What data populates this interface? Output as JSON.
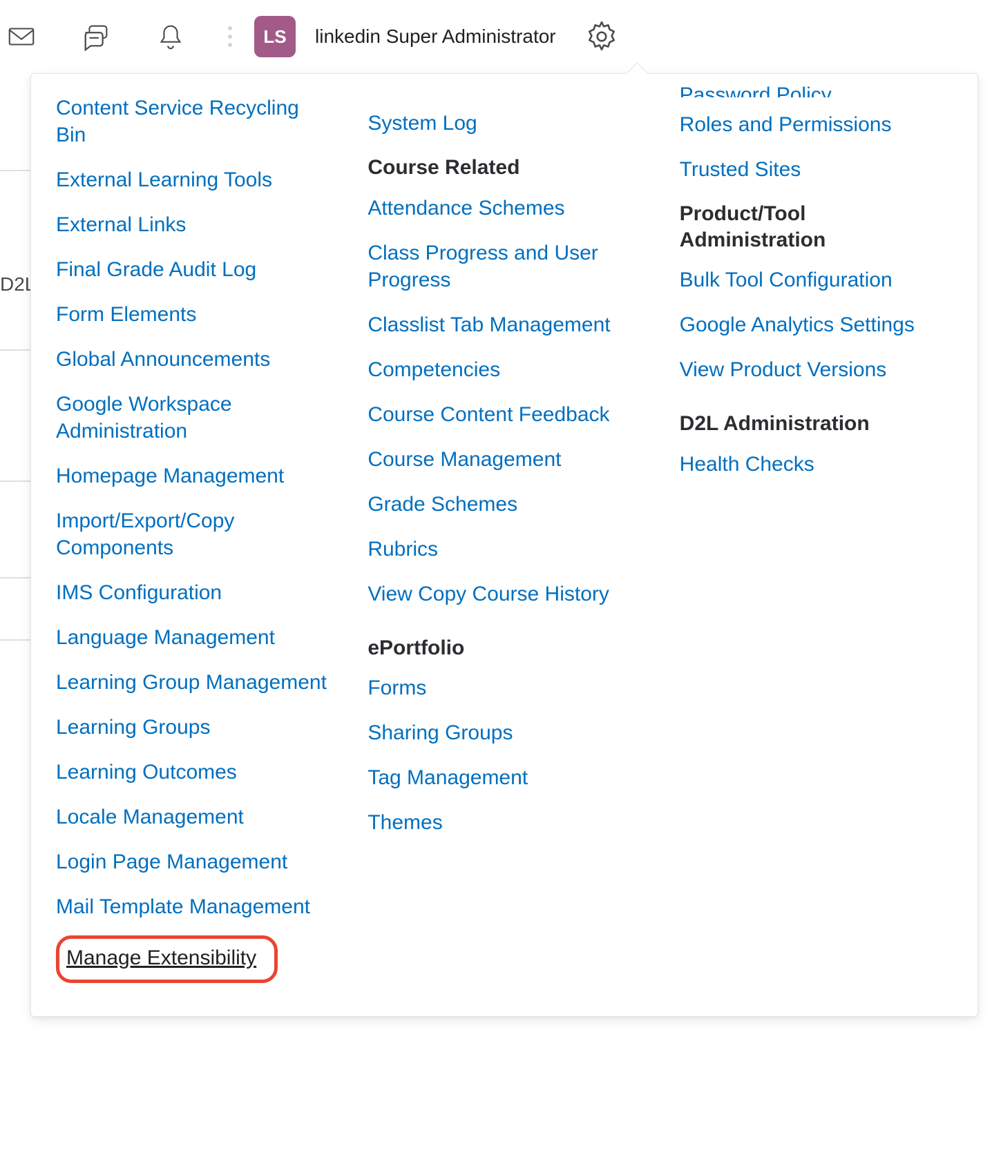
{
  "topbar": {
    "avatar_initials": "LS",
    "username": "linkedin Super Administrator"
  },
  "background": {
    "left_label": "D2L"
  },
  "panel": {
    "col1": {
      "links": [
        "Content Service Recycling Bin",
        "External Learning Tools",
        "External Links",
        "Final Grade Audit Log",
        "Form Elements",
        "Global Announcements",
        "Google Workspace Administration",
        "Homepage Management",
        "Import/Export/Copy Components",
        "IMS Configuration",
        "Language Management",
        "Learning Group Management",
        "Learning Groups",
        "Learning Outcomes",
        "Locale Management",
        "Login Page Management",
        "Mail Template Management"
      ],
      "highlight": "Manage Extensibility"
    },
    "col2": {
      "top_link": "System Log",
      "s1": {
        "title": "Course Related",
        "links": [
          "Attendance Schemes",
          "Class Progress and User Progress",
          "Classlist Tab Management",
          "Competencies",
          "Course Content Feedback",
          "Course Management",
          "Grade Schemes",
          "Rubrics",
          "View Copy Course History"
        ]
      },
      "s2": {
        "title": "ePortfolio",
        "links": [
          "Forms",
          "Sharing Groups",
          "Tag Management",
          "Themes"
        ]
      }
    },
    "col3": {
      "trunc": "Password Policy",
      "top_links": [
        "Roles and Permissions",
        "Trusted Sites"
      ],
      "s1": {
        "title": "Product/Tool Administration",
        "links": [
          "Bulk Tool Configuration",
          "Google Analytics Settings",
          "View Product Versions"
        ]
      },
      "s2": {
        "title": "D2L Administration",
        "links": [
          "Health Checks"
        ]
      }
    }
  }
}
